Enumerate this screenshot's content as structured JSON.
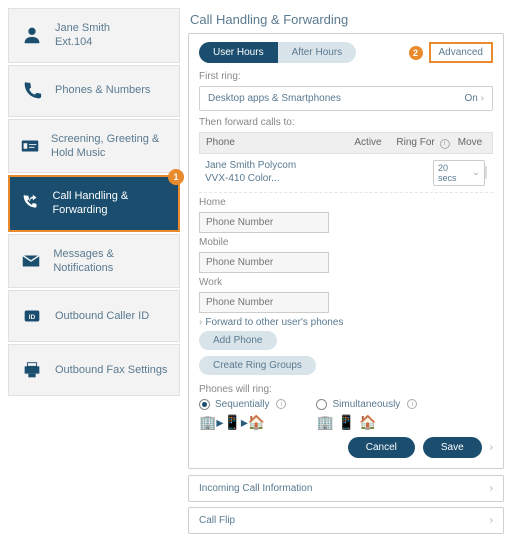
{
  "sidebar": {
    "items": [
      {
        "label_line1": "Jane Smith",
        "label_line2": "Ext.104"
      },
      {
        "label": "Phones & Numbers"
      },
      {
        "label": "Screening, Greeting & Hold Music"
      },
      {
        "label": "Call Handling & Forwarding",
        "badge": "1"
      },
      {
        "label": "Messages & Notifications"
      },
      {
        "label": "Outbound Caller ID"
      },
      {
        "label": "Outbound Fax Settings"
      }
    ]
  },
  "panel": {
    "title": "Call Handling & Forwarding",
    "tabs": {
      "user_hours": "User Hours",
      "after_hours": "After Hours"
    },
    "adv_badge": "2",
    "advanced": "Advanced",
    "first_ring_label": "First ring:",
    "first_ring_value": "Desktop apps & Smartphones",
    "first_ring_state": "On",
    "forward_label": "Then forward calls to:",
    "table": {
      "phone": "Phone",
      "active": "Active",
      "ring_for": "Ring For",
      "move": "Move"
    },
    "row1": {
      "line1": "Jane Smith Polycom",
      "line2": "VVX-410 Color...",
      "ring": "20 secs"
    },
    "groups": [
      {
        "label": "Home",
        "placeholder": "Phone Number"
      },
      {
        "label": "Mobile",
        "placeholder": "Phone Number"
      },
      {
        "label": "Work",
        "placeholder": "Phone Number"
      }
    ],
    "forward_other": "Forward to other user's phones",
    "add_phone": "Add Phone",
    "create_groups": "Create Ring Groups",
    "phones_will_ring": "Phones will ring:",
    "sequential": "Sequentially",
    "simultaneous": "Simultaneously",
    "cancel": "Cancel",
    "save": "Save"
  },
  "expanders": {
    "incoming": "Incoming Call Information",
    "flip": "Call Flip"
  }
}
